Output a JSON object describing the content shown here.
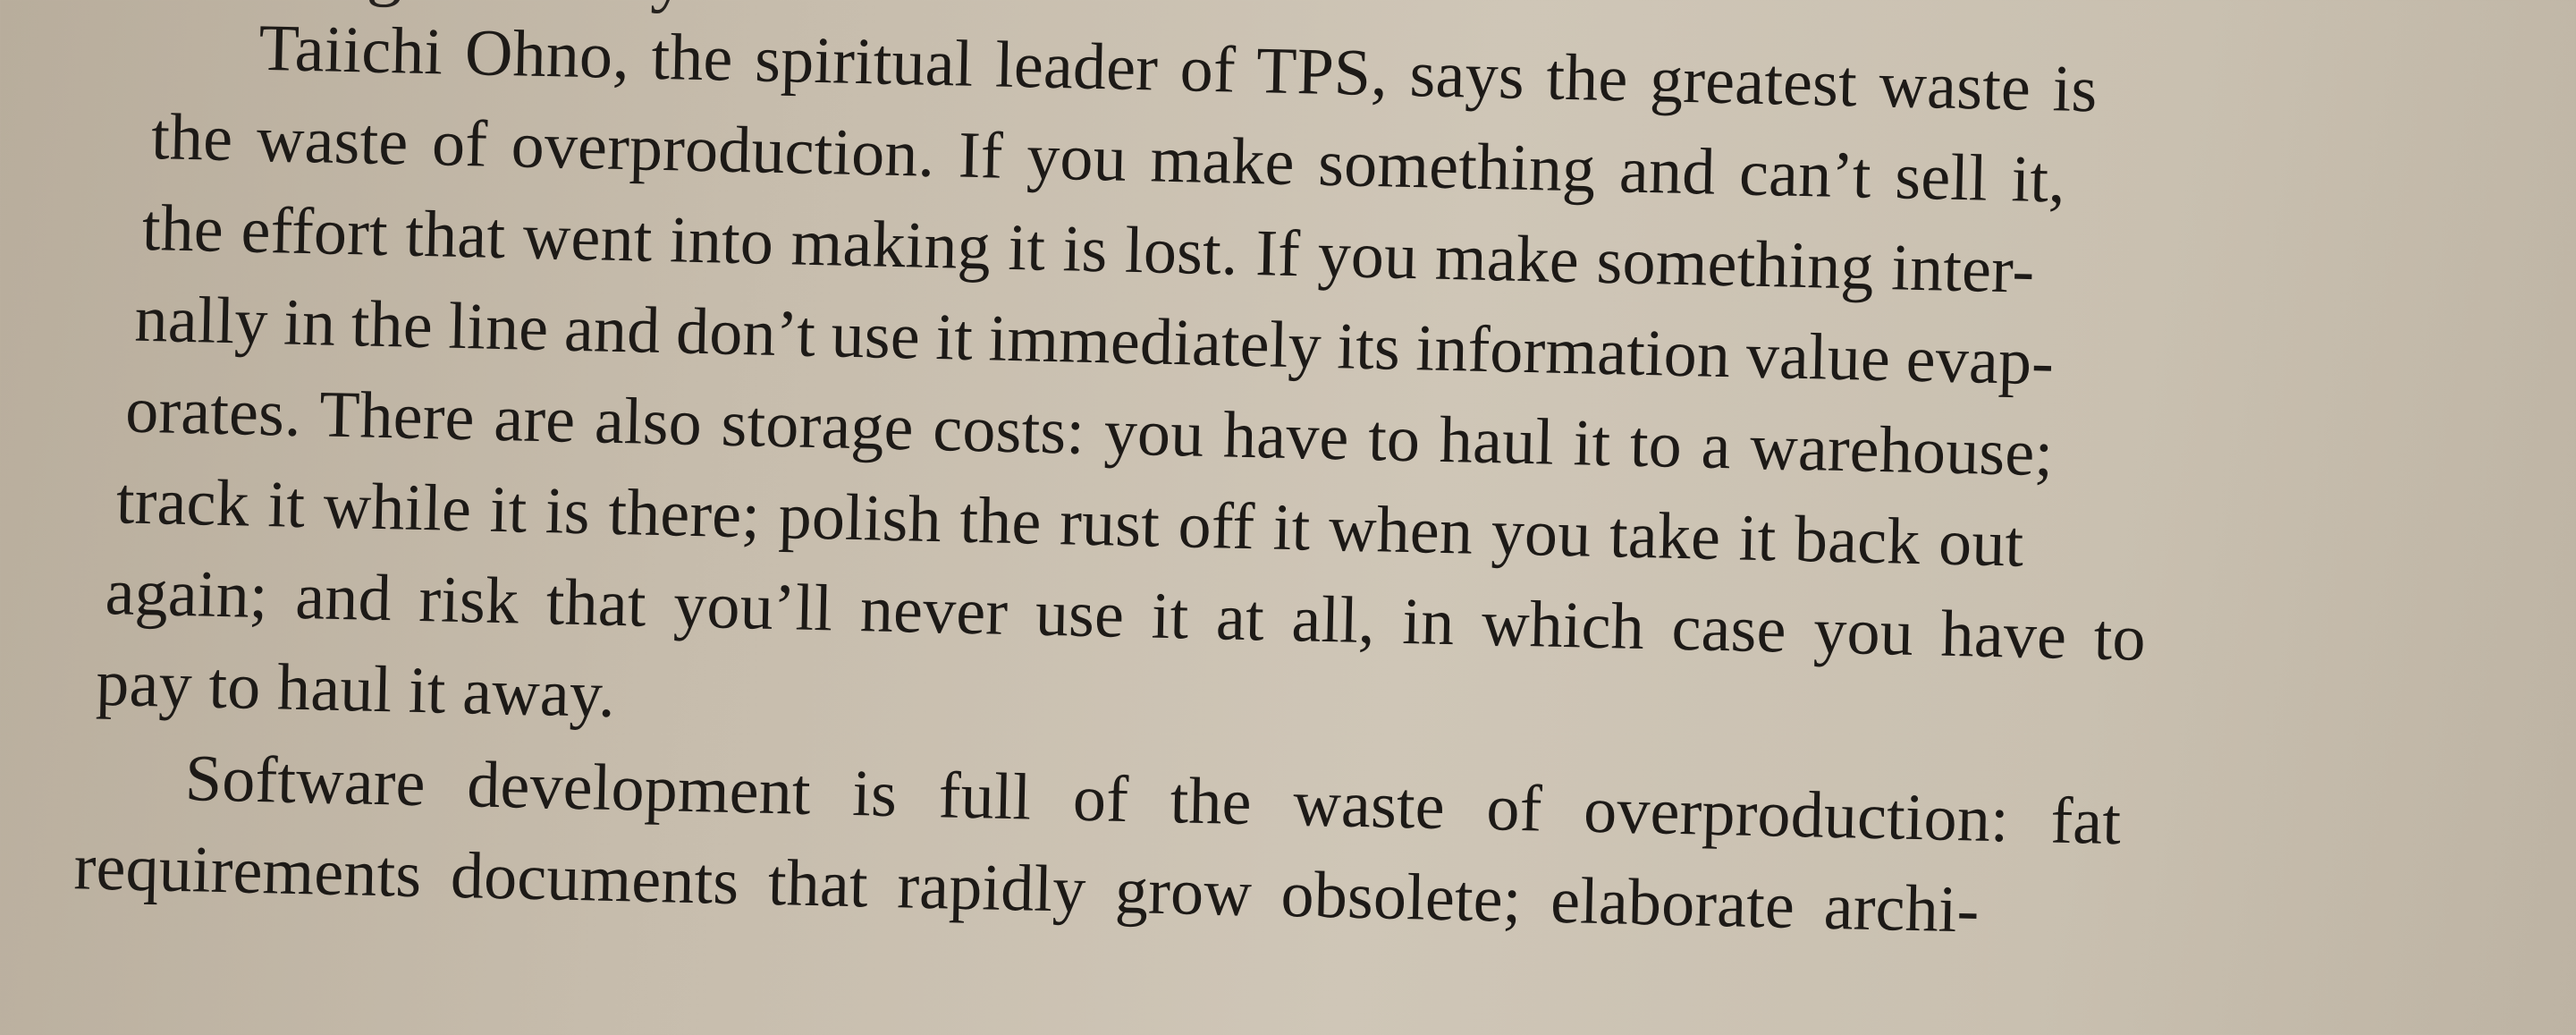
{
  "book_text": {
    "partial_top_line": "working smoothly.”",
    "lines": [
      "Taiichi Ohno, the spiritual leader of TPS, says the greatest waste is",
      "the waste of overproduction. If you make something and can’t sell it,",
      "the effort that went into making it is lost. If you make something inter-",
      "nally in the line and don’t use it immediately its information value evap-",
      "orates. There are also storage costs: you have to haul it to a warehouse;",
      "track it while it is there; polish the rust off it when you take it back out",
      "again; and risk that you’ll never use it at all, in which case you have to",
      "pay to haul it away.",
      "Software development is full of the waste of overproduction: fat",
      "requirements documents that rapidly grow obsolete; elaborate archi-"
    ]
  }
}
